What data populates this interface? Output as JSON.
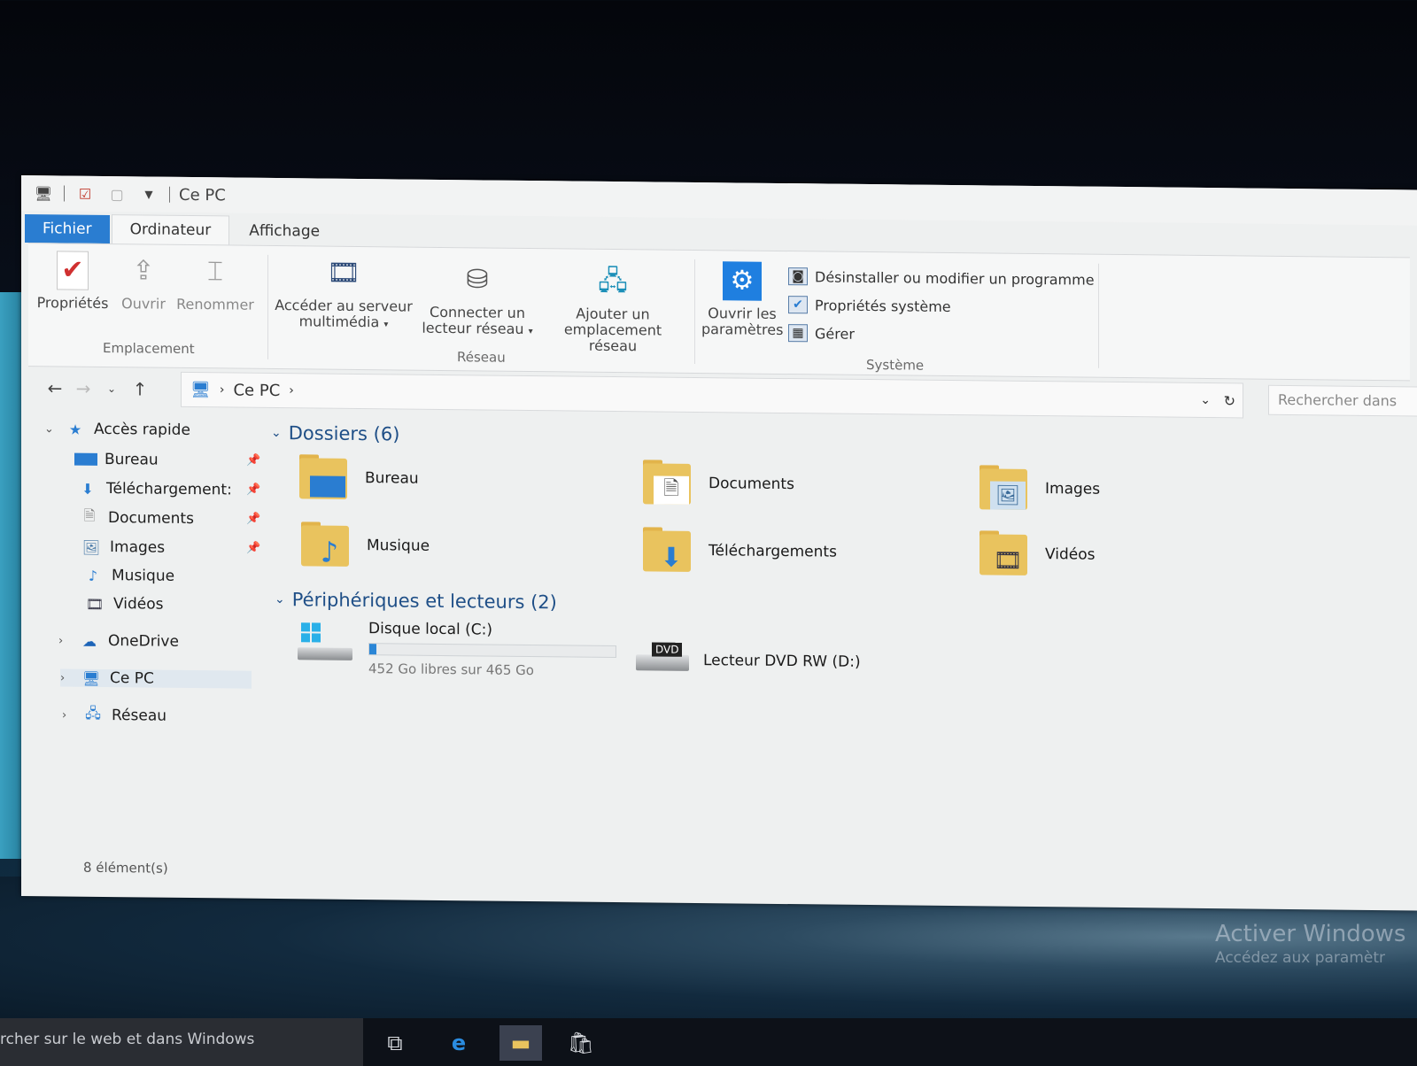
{
  "window": {
    "title": "Ce PC",
    "tabs": [
      "Fichier",
      "Ordinateur",
      "Affichage"
    ]
  },
  "ribbon": {
    "emplacement": {
      "label": "Emplacement",
      "buttons": [
        "Propriétés",
        "Ouvrir",
        "Renommer"
      ]
    },
    "reseau": {
      "label": "Réseau",
      "multimedia_line1": "Accéder au serveur",
      "multimedia_line2": "multimédia",
      "connect_line1": "Connecter un",
      "connect_line2": "lecteur réseau",
      "add_line1": "Ajouter un",
      "add_line2": "emplacement réseau"
    },
    "systeme": {
      "label": "Système",
      "settings_line1": "Ouvrir les",
      "settings_line2": "paramètres",
      "uninstall": "Désinstaller ou modifier un programme",
      "sysprops": "Propriétés système",
      "manage": "Gérer"
    }
  },
  "address": {
    "path": "Ce PC",
    "search_placeholder": "Rechercher dans"
  },
  "navpane": {
    "quick_access": "Accès rapide",
    "pinned": [
      "Bureau",
      "Téléchargement:",
      "Documents",
      "Images"
    ],
    "other": [
      "Musique",
      "Vidéos"
    ],
    "onedrive": "OneDrive",
    "this_pc": "Ce PC",
    "network": "Réseau"
  },
  "content": {
    "folders_header": "Dossiers (6)",
    "folders": [
      "Bureau",
      "Documents",
      "Images",
      "Musique",
      "Téléchargements",
      "Vidéos"
    ],
    "devices_header": "Périphériques et lecteurs (2)",
    "drive_c": {
      "name": "Disque local (C:)",
      "space": "452 Go libres sur 465 Go",
      "used_fraction": 0.028
    },
    "drive_d": {
      "name": "Lecteur DVD RW (D:)",
      "badge": "DVD"
    }
  },
  "status": "8 élément(s)",
  "watermark": {
    "line1": "Activer Windows",
    "line2": "Accédez aux paramètr"
  },
  "taskbar": {
    "search": "rcher sur le web et dans Windows"
  },
  "colors": {
    "accent": "#2a7dd1",
    "section_header": "#1f4f87",
    "folder": "#e9c35e"
  }
}
